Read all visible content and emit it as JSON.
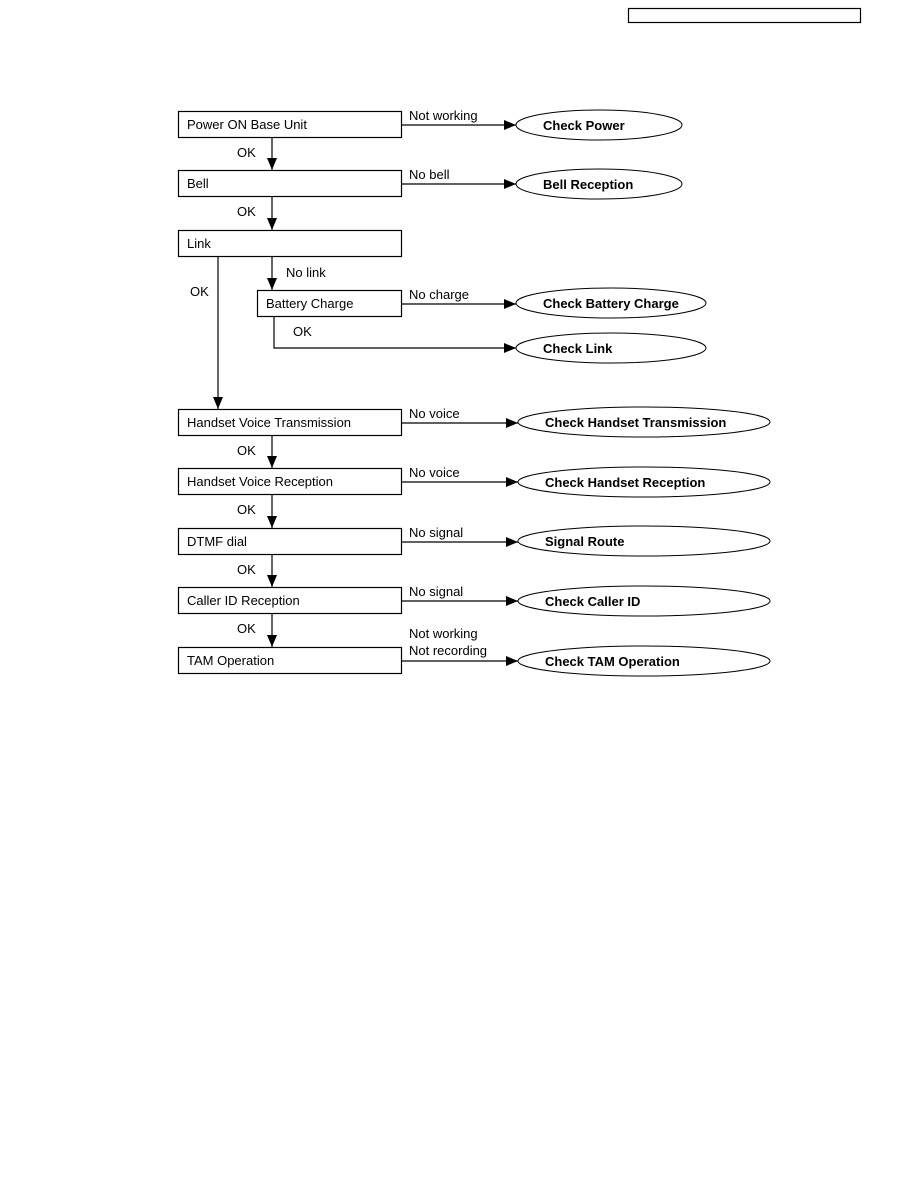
{
  "header_box_text": "",
  "processes": [
    {
      "id": "power",
      "label": "Power ON Base Unit"
    },
    {
      "id": "bell",
      "label": "Bell"
    },
    {
      "id": "link",
      "label": "Link"
    },
    {
      "id": "battery",
      "label": "Battery Charge"
    },
    {
      "id": "htx",
      "label": "Handset Voice Transmission"
    },
    {
      "id": "hrx",
      "label": "Handset Voice Reception"
    },
    {
      "id": "dtmf",
      "label": "DTMF dial"
    },
    {
      "id": "cid",
      "label": "Caller ID Reception"
    },
    {
      "id": "tam",
      "label": "TAM Operation"
    }
  ],
  "results": [
    {
      "id": "r_power",
      "label": "Check Power"
    },
    {
      "id": "r_bell",
      "label": "Bell Reception"
    },
    {
      "id": "r_batt",
      "label": "Check Battery Charge"
    },
    {
      "id": "r_link",
      "label": "Check Link"
    },
    {
      "id": "r_htx",
      "label": "Check Handset Transmission"
    },
    {
      "id": "r_hrx",
      "label": "Check Handset Reception"
    },
    {
      "id": "r_sig",
      "label": "Signal Route"
    },
    {
      "id": "r_cid",
      "label": "Check Caller ID"
    },
    {
      "id": "r_tam",
      "label": "Check TAM Operation"
    }
  ],
  "edges": [
    {
      "from": "power",
      "to": "r_power",
      "label": "Not working"
    },
    {
      "from": "power",
      "to": "bell",
      "label": "OK"
    },
    {
      "from": "bell",
      "to": "r_bell",
      "label": "No bell"
    },
    {
      "from": "bell",
      "to": "link",
      "label": "OK"
    },
    {
      "from": "link",
      "to": "battery",
      "label": "No link"
    },
    {
      "from": "link",
      "to": "htx",
      "label": "OK"
    },
    {
      "from": "battery",
      "to": "r_batt",
      "label": "No charge"
    },
    {
      "from": "battery",
      "to": "r_link",
      "label": "OK"
    },
    {
      "from": "htx",
      "to": "r_htx",
      "label": "No voice"
    },
    {
      "from": "htx",
      "to": "hrx",
      "label": "OK"
    },
    {
      "from": "hrx",
      "to": "r_hrx",
      "label": "No voice"
    },
    {
      "from": "hrx",
      "to": "dtmf",
      "label": "OK"
    },
    {
      "from": "dtmf",
      "to": "r_sig",
      "label": "No signal"
    },
    {
      "from": "dtmf",
      "to": "cid",
      "label": "OK"
    },
    {
      "from": "cid",
      "to": "r_cid",
      "label": "No signal"
    },
    {
      "from": "cid",
      "to": "tam",
      "label": "OK"
    },
    {
      "from": "tam",
      "to": "r_tam",
      "label": "Not working\nNot recording"
    }
  ]
}
